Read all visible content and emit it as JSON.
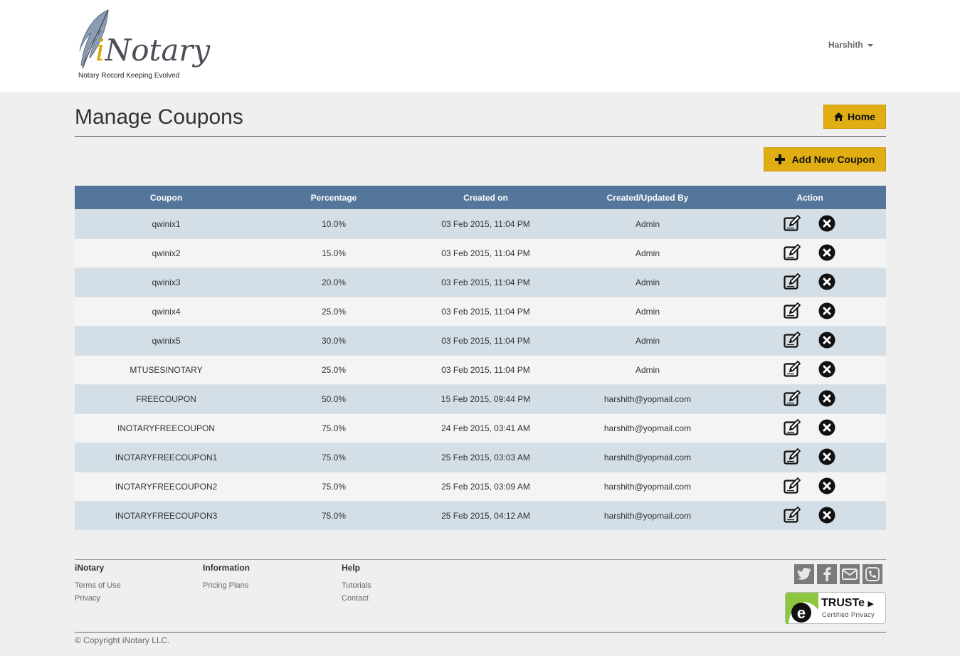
{
  "brand": {
    "name_prefix": "i",
    "name_rest": "Notary",
    "tagline": "Notary Record Keeping Evolved"
  },
  "user": {
    "name": "Harshith"
  },
  "page": {
    "title": "Manage Coupons"
  },
  "buttons": {
    "home": "Home",
    "add_coupon": "Add New Coupon"
  },
  "table": {
    "headers": [
      "Coupon",
      "Percentage",
      "Created on",
      "Created/Updated By",
      "Action"
    ],
    "rows": [
      [
        "qwinix1",
        "10.0%",
        "03 Feb 2015, 11:04 PM",
        "Admin"
      ],
      [
        "qwinix2",
        "15.0%",
        "03 Feb 2015, 11:04 PM",
        "Admin"
      ],
      [
        "qwinix3",
        "20.0%",
        "03 Feb 2015, 11:04 PM",
        "Admin"
      ],
      [
        "qwinix4",
        "25.0%",
        "03 Feb 2015, 11:04 PM",
        "Admin"
      ],
      [
        "qwinix5",
        "30.0%",
        "03 Feb 2015, 11:04 PM",
        "Admin"
      ],
      [
        "MTUSESINOTARY",
        "25.0%",
        "03 Feb 2015, 11:04 PM",
        "Admin"
      ],
      [
        "FREECOUPON",
        "50.0%",
        "15 Feb 2015, 09:44 PM",
        "harshith@yopmail.com"
      ],
      [
        "INOTARYFREECOUPON",
        "75.0%",
        "24 Feb 2015, 03:41 AM",
        "harshith@yopmail.com"
      ],
      [
        "INOTARYFREECOUPON1",
        "75.0%",
        "25 Feb 2015, 03:03 AM",
        "harshith@yopmail.com"
      ],
      [
        "INOTARYFREECOUPON2",
        "75.0%",
        "25 Feb 2015, 03:09 AM",
        "harshith@yopmail.com"
      ],
      [
        "INOTARYFREECOUPON3",
        "75.0%",
        "25 Feb 2015, 04:12 AM",
        "harshith@yopmail.com"
      ]
    ]
  },
  "footer": {
    "col1": {
      "title": "iNotary",
      "links": [
        "Terms of Use",
        "Privacy"
      ]
    },
    "col2": {
      "title": "Information",
      "links": [
        "Pricing Plans"
      ]
    },
    "col3": {
      "title": "Help",
      "links": [
        "Tutorials",
        "Contact"
      ]
    },
    "social_icons": [
      "twitter-icon",
      "facebook-icon",
      "email-icon",
      "phone-icon"
    ],
    "truste": {
      "brand": "TRUSTe",
      "sub": "Certified Privacy"
    },
    "copyright": "© Copyright iNotary LLC."
  },
  "colors": {
    "accent": "#e0ae12",
    "table_header": "#53769a",
    "row_alt": "#d3dee6"
  }
}
